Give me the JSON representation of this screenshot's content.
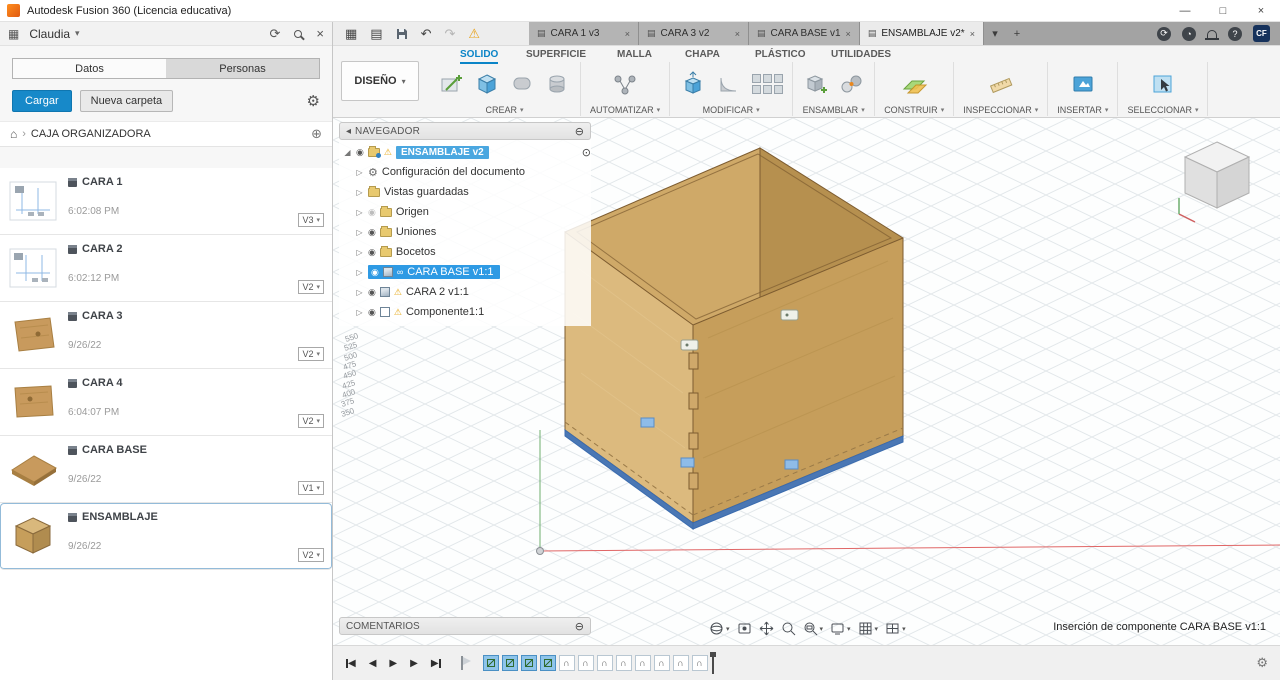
{
  "titlebar": {
    "title": "Autodesk Fusion 360 (Licencia educativa)",
    "minimize": "—",
    "maximize": "□",
    "close": "×"
  },
  "icons": {
    "app_grid": "▦",
    "panel": "▤",
    "chevron_down": "▾",
    "caret_right": "▷",
    "caret_open": "◢",
    "warning": "⚠",
    "eye": "◉",
    "gear": "⚙",
    "close": "×",
    "plus": "+",
    "home": "⌂",
    "crumb_sep": "›",
    "link": "∞",
    "refresh": "⟳",
    "collapse": "◂",
    "circle_minus": "⊖",
    "circle_dot": "⊙",
    "undo": "↶",
    "redo": "↷",
    "joint": "∩",
    "play": "▶",
    "step_back": "◀",
    "share": "⊕",
    "help": "?",
    "status": "◔"
  },
  "sidebar": {
    "user": "Claudia",
    "tabs": [
      {
        "label": "Datos"
      },
      {
        "label": "Personas"
      }
    ],
    "upload": "Cargar",
    "new_folder": "Nueva carpeta",
    "breadcrumb": "CAJA ORGANIZADORA",
    "items": [
      {
        "name": "CARA 1",
        "date": "6:02:08 PM",
        "version": "V3"
      },
      {
        "name": "CARA 2",
        "date": "6:02:12 PM",
        "version": "V2"
      },
      {
        "name": "CARA 3",
        "date": "9/26/22",
        "version": "V2"
      },
      {
        "name": "CARA 4",
        "date": "6:04:07 PM",
        "version": "V2"
      },
      {
        "name": "CARA BASE",
        "date": "9/26/22",
        "version": "V1"
      },
      {
        "name": "ENSAMBLAJE",
        "date": "9/26/22",
        "version": "V2"
      }
    ]
  },
  "doc_tabs": {
    "tabs": [
      {
        "label": "CARA 1 v3"
      },
      {
        "label": "CARA 3 v2"
      },
      {
        "label": "CARA BASE v1"
      },
      {
        "label": "ENSAMBLAJE v2*"
      }
    ],
    "avatar": "CF"
  },
  "ribbon": {
    "design": "DISEÑO",
    "tabs": [
      {
        "label": "SOLIDO"
      },
      {
        "label": "SUPERFICIE"
      },
      {
        "label": "MALLA"
      },
      {
        "label": "CHAPA"
      },
      {
        "label": "PLÁSTICO"
      },
      {
        "label": "UTILIDADES"
      }
    ],
    "groups": [
      {
        "label": "CREAR"
      },
      {
        "label": "AUTOMATIZAR"
      },
      {
        "label": "MODIFICAR"
      },
      {
        "label": "ENSAMBLAR"
      },
      {
        "label": "CONSTRUIR"
      },
      {
        "label": "INSPECCIONAR"
      },
      {
        "label": "INSERTAR"
      },
      {
        "label": "SELECCIONAR"
      }
    ]
  },
  "navigator": {
    "title": "NAVEGADOR",
    "root_label": "ENSAMBLAJE v2",
    "rows": [
      {
        "label": "Configuración del documento"
      },
      {
        "label": "Vistas guardadas"
      },
      {
        "label": "Origen"
      },
      {
        "label": "Uniones"
      },
      {
        "label": "Bocetos"
      },
      {
        "label": "CARA BASE v1:1"
      },
      {
        "label": "CARA 2 v1:1"
      },
      {
        "label": "Componente1:1"
      }
    ]
  },
  "viewport": {
    "ruler_values": [
      "550",
      "525",
      "500",
      "475",
      "450",
      "425",
      "400",
      "375",
      "350"
    ],
    "comments_label": "COMENTARIOS",
    "status_text": "Inserción de componente CARA BASE v1:1"
  },
  "colors": {
    "accent_blue": "#0696d7",
    "selection_blue": "#2e9ae4",
    "wood_light": "#dcba7e",
    "wood_medium": "#c69e5b",
    "wood_interior": "#b6904f",
    "base_blue": "#5f8fd0",
    "warning_yellow": "#e8a21a"
  }
}
